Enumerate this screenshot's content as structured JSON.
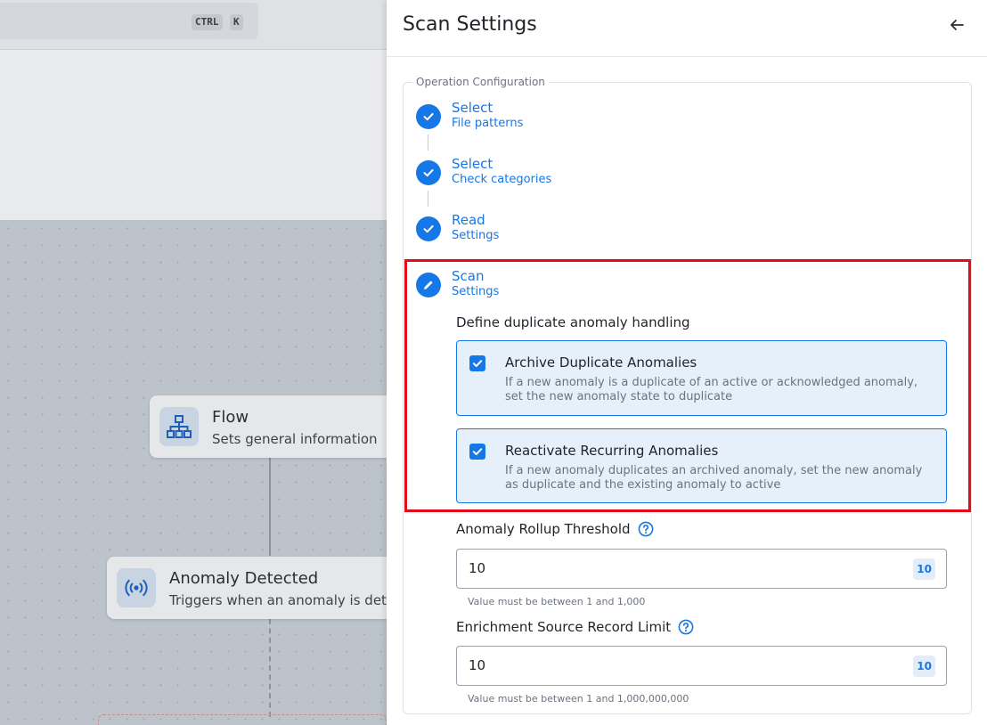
{
  "background": {
    "shortcut_keys": [
      "CTRL",
      "K"
    ],
    "nodes": [
      {
        "title": "Flow",
        "subtitle": "Sets general information",
        "icon": "sitemap-icon"
      },
      {
        "title": "Anomaly Detected",
        "subtitle": "Triggers when an anomaly is dete",
        "icon": "broadcast-icon"
      }
    ]
  },
  "drawer": {
    "title": "Scan Settings",
    "back_icon": "arrow-left-icon",
    "section_legend": "Operation Configuration",
    "steps": [
      {
        "title": "Select",
        "subtitle": "File patterns",
        "state": "completed"
      },
      {
        "title": "Select",
        "subtitle": "Check categories",
        "state": "completed"
      },
      {
        "title": "Read",
        "subtitle": "Settings",
        "state": "completed"
      },
      {
        "title": "Scan",
        "subtitle": "Settings",
        "state": "editing"
      }
    ],
    "duplicate_heading": "Define duplicate anomaly handling",
    "options": [
      {
        "title": "Archive Duplicate Anomalies",
        "description": "If a new anomaly is a duplicate of an active or acknowledged anomaly, set the new anomaly state to duplicate",
        "checked": true
      },
      {
        "title": "Reactivate Recurring Anomalies",
        "description": "If a new anomaly duplicates an archived anomaly, set the new anomaly as duplicate and the existing anomaly to active",
        "checked": true
      }
    ],
    "fields": [
      {
        "label": "Anomaly Rollup Threshold",
        "value": "10",
        "badge": "10",
        "helper": "Value must be between 1 and 1,000"
      },
      {
        "label": "Enrichment Source Record Limit",
        "value": "10",
        "badge": "10",
        "helper": "Value must be between 1 and 1,000,000,000"
      }
    ]
  },
  "colors": {
    "accent": "#1677e6",
    "highlight": "#e30b17",
    "card_bg": "#e6f0fb"
  }
}
